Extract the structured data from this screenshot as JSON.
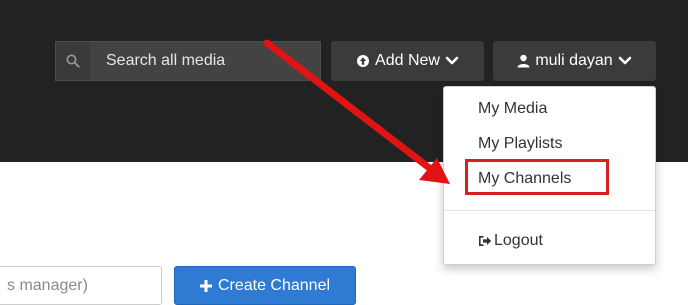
{
  "header": {
    "search": {
      "placeholder": "Search all media",
      "icon": "search-icon"
    },
    "add_new": {
      "label": "Add New",
      "icon": "circle-arrow-up-icon",
      "caret": "chevron-down-icon"
    },
    "user": {
      "label": "muli dayan",
      "icon": "user-icon",
      "caret": "chevron-down-icon"
    }
  },
  "user_dropdown": {
    "items": [
      {
        "label": "My Media"
      },
      {
        "label": "My Playlists"
      },
      {
        "label": "My Channels"
      }
    ],
    "logout": {
      "label": "Logout",
      "icon": "sign-out-icon"
    }
  },
  "main": {
    "manager_field_text": "s manager)",
    "create_channel": {
      "label": "Create Channel",
      "icon": "plus-icon"
    }
  },
  "colors": {
    "topbar": "#222222",
    "highlight": "#d72020",
    "primary_button": "#2f7ad2"
  }
}
